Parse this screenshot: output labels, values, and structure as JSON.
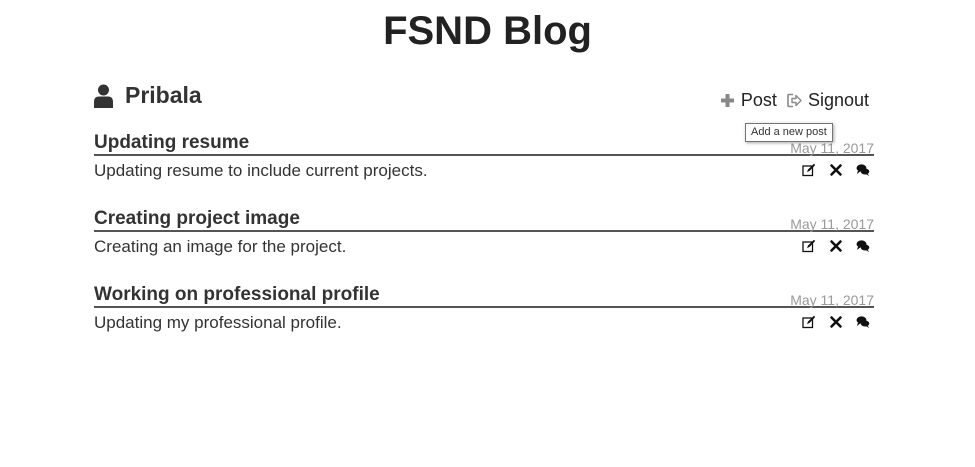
{
  "site": {
    "title": "FSND Blog"
  },
  "user": {
    "icon": "user-icon",
    "name": "Pribala"
  },
  "actions": {
    "post_label": "Post",
    "post_icon": "plus-icon",
    "post_tooltip": "Add a new post",
    "signout_label": "Signout",
    "signout_icon": "signout-icon"
  },
  "posts": [
    {
      "title": "Updating resume",
      "date": "May 11, 2017",
      "content": "Updating resume to include current projects."
    },
    {
      "title": "Creating project image",
      "date": "May 11, 2017",
      "content": "Creating an image for the project."
    },
    {
      "title": "Working on professional profile",
      "date": "May 11, 2017",
      "content": "Updating my professional profile."
    }
  ],
  "post_tools": {
    "edit_icon": "edit-icon",
    "delete_icon": "delete-icon",
    "comment_icon": "comment-icon"
  },
  "colors": {
    "text": "#333333",
    "muted": "#999999",
    "rule": "#555555"
  }
}
